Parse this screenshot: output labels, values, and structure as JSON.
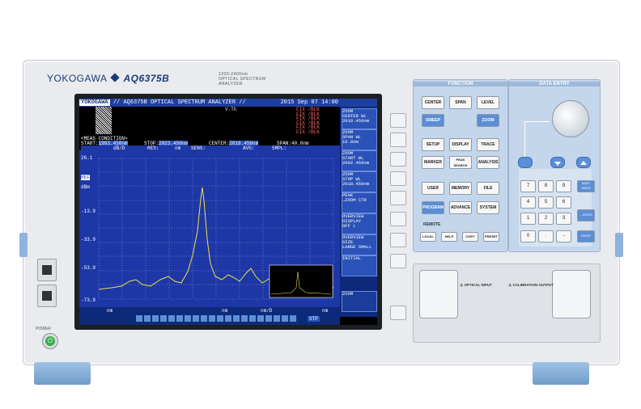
{
  "device": {
    "brand": "YOKOGAWA",
    "model": "AQ6375B",
    "model_sub_line1": "1200-2400nm",
    "model_sub_line2": "OPTICAL SPECTRUM ANALYZER",
    "power_label": "POWER"
  },
  "screen": {
    "header_title": "// AQ6375B OPTICAL SPECTRUM ANALYZER //",
    "header_logo": "YOKOGAWA",
    "header_date": "2015 Sep 07 14:00",
    "trace_label": "V-Th",
    "trace_rows": [
      "FIX /BLK",
      "FIX /BLK",
      "FIX /BLK",
      "FIX /BLK",
      "FIX /BLK",
      "FIX /BLK"
    ],
    "meas_condition": "<MEAS CONDITION>",
    "start_label": "START:",
    "start_value": "1993.450nm",
    "stop_label": "STOP:",
    "stop_value": "2023.450nm",
    "center_label": "CENTER:",
    "center_value": "2018.450nm",
    "span_label": "SPAN:",
    "span_value": "40.0nm",
    "scale_label": "dB/D",
    "res_label": "RES:",
    "res_unit": "nm",
    "sens_label": "SENS:",
    "avg_label": "AVG:",
    "smpl_label": "SMPL:",
    "y_ticks": [
      "26.1",
      "REF",
      "-13.9",
      "-33.9",
      "-53.9",
      "-73.9"
    ],
    "y_unit": "dBm",
    "bottom_left_unit": "nm",
    "bottom_mid_unit": "nm",
    "bottom_mid2_unit": "nm/D",
    "bottom_right_unit": "nm",
    "bottom_tag": "STP",
    "softkeys": [
      {
        "line1": "ZOOM",
        "line2": "CENTER WL",
        "line3": "2018.450nm"
      },
      {
        "line1": "ZOOM",
        "line2": "SPAN WL",
        "line3": "16.0nm"
      },
      {
        "line1": "ZOOM",
        "line2": "START WL",
        "line3": "2002.450nm"
      },
      {
        "line1": "ZOOM",
        "line2": "STOP WL",
        "line3": "2018.450nm"
      },
      {
        "line1": "PEAK",
        "line2": "→ZOOM CTR",
        "line3": ""
      },
      {
        "line1": "OVERVIEW",
        "line2": "DISPLAY",
        "line3": "OFF  L"
      },
      {
        "line1": "OVERVIEW",
        "line2": "SIZE",
        "line3": "LARGE SMALL"
      },
      {
        "line1": "INITIAL",
        "line2": "",
        "line3": ""
      },
      {
        "line1": "ZOOM",
        "line2": "",
        "line3": ""
      }
    ]
  },
  "function_panel": {
    "title": "FUNCTION",
    "keys": [
      "CENTER",
      "SPAN",
      "LEVEL",
      "SWEEP",
      "ZOOM",
      "SETUP",
      "DISPLAY",
      "TRACE",
      "MARKER",
      "PEAK SEARCH",
      "ANALYSIS",
      "USER",
      "MEMORY",
      "FILE",
      "PROGRAM",
      "ADVANCE",
      "SYSTEM"
    ],
    "remote_label": "REMOTE",
    "small_keys": [
      "LOCAL",
      "HELP",
      "COPY",
      "PRESET"
    ]
  },
  "data_entry": {
    "title": "DATA ENTRY",
    "numpad": [
      "7",
      "8",
      "9",
      "4",
      "5",
      "6",
      "1",
      "2",
      "3",
      "0",
      ".",
      "-"
    ],
    "side_keys": [
      "BACK SPACE",
      "←ENTER",
      "ENTER"
    ]
  },
  "ports": {
    "optical_input": "OPTICAL INPUT",
    "calibration_output": "CALIBRATION OUTPUT"
  },
  "colors": {
    "graph_bg": "#1d37a6",
    "trace": "#f0e04a",
    "panel_blue": "#c4d6eb",
    "power_green": "#35b04a"
  }
}
